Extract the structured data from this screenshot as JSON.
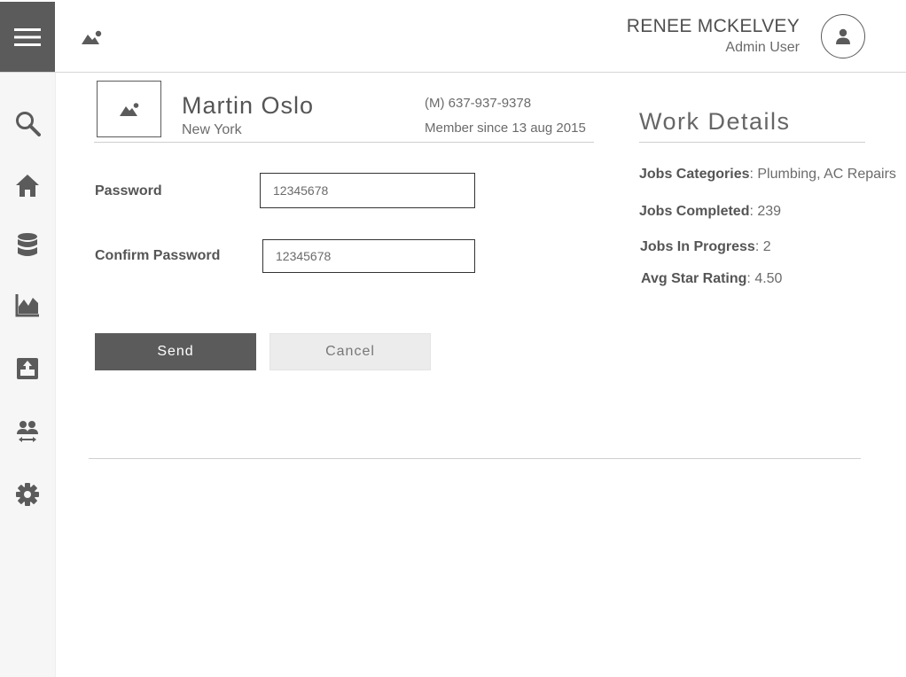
{
  "header": {
    "user_name": "RENEE MCKELVEY",
    "user_role": "Admin User",
    "icons": [
      "menu-icon",
      "logo-image-icon",
      "user-avatar-icon"
    ]
  },
  "sidebar": {
    "items": [
      {
        "icon": "search-icon"
      },
      {
        "icon": "home-icon"
      },
      {
        "icon": "database-icon"
      },
      {
        "icon": "chart-icon"
      },
      {
        "icon": "upload-inbox-icon"
      },
      {
        "icon": "users-transfer-icon"
      },
      {
        "icon": "gear-icon"
      }
    ]
  },
  "profile": {
    "name": "Martin Oslo",
    "city": "New York",
    "phone": "(M) 637-937-9378",
    "member_since": "Member since 13 aug 2015"
  },
  "form": {
    "password_label": "Password",
    "password_value": "12345678",
    "confirm_label": "Confirm Password",
    "confirm_value": "12345678",
    "send_label": "Send",
    "cancel_label": "Cancel"
  },
  "work": {
    "title": "Work Details",
    "rows": [
      {
        "key": "Jobs Categories",
        "value": ": Plumbing, AC Repairs"
      },
      {
        "key": "Jobs Completed",
        "value": ": 239"
      },
      {
        "key": "Jobs In Progress",
        "value": ": 2"
      },
      {
        "key": "Avg Star Rating",
        "value": ": 4.50"
      }
    ]
  },
  "colors": {
    "dark": "#5b5b5b",
    "sidebar_bg": "#f6f6f6",
    "cancel_bg": "#ececec"
  }
}
